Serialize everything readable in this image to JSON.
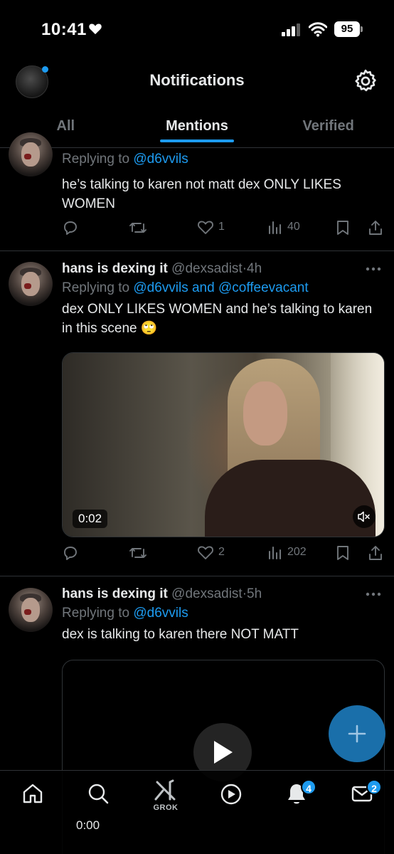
{
  "status_bar": {
    "time": "10:41",
    "battery": "95"
  },
  "header": {
    "title": "Notifications"
  },
  "tabs": [
    {
      "label": "All"
    },
    {
      "label": "Mentions"
    },
    {
      "label": "Verified"
    }
  ],
  "active_tab": "Mentions",
  "tweets": [
    {
      "replying_prefix": "Replying to ",
      "replying_to": "@d6vvils",
      "text": "he’s talking to karen not matt dex ONLY LIKES WOMEN",
      "likes": "1",
      "views": "40"
    },
    {
      "author": "hans is dexing it",
      "handle": "@dexsadist",
      "time": "·4h",
      "replying_prefix": "Replying to ",
      "replying_to": "@d6vvils and @coffeevacant",
      "text": "dex ONLY LIKES WOMEN and he’s talking to karen in this scene 🙄",
      "video_time": "0:02",
      "likes": "2",
      "views": "202"
    },
    {
      "author": "hans is dexing it",
      "handle": "@dexsadist",
      "time": "·5h",
      "replying_prefix": "Replying to ",
      "replying_to": "@d6vvils",
      "text": "dex is talking to karen there NOT MATT",
      "video_time": "0:00"
    }
  ],
  "bottom_nav": {
    "grok_label": "GROK",
    "notifications_badge": "4",
    "messages_badge": "2"
  },
  "colors": {
    "accent": "#1d9bf0",
    "background": "#000000",
    "muted": "#71767b",
    "fab": "#1a6faa"
  },
  "icons": [
    "heart-icon",
    "signal-icon",
    "wifi-icon",
    "settings-icon",
    "reply-icon",
    "retweet-icon",
    "like-icon",
    "views-icon",
    "bookmark-icon",
    "share-icon",
    "more-icon",
    "mute-icon",
    "play-icon",
    "compose-icon",
    "home-icon",
    "search-icon",
    "grok-icon",
    "video-icon",
    "bell-icon",
    "mail-icon"
  ]
}
